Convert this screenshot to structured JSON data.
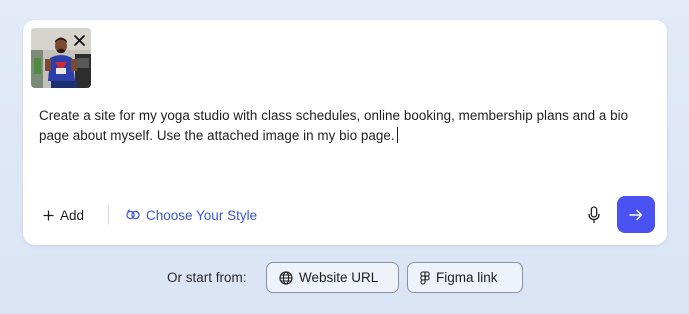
{
  "composer": {
    "attachment_alt": "Attached photo",
    "remove_icon": "close-icon",
    "prompt_text": "Create a site for my yoga studio with class schedules, online booking, membership plans and a bio page about myself. Use the attached image in my bio page.",
    "add_label": "Add",
    "add_icon": "plus-icon",
    "style_label": "Choose Your Style",
    "style_icon": "palette-icon",
    "mic_icon": "microphone-icon",
    "send_icon": "arrow-right-icon"
  },
  "start_from": {
    "label": "Or start from:",
    "options": [
      {
        "label": "Website URL",
        "icon": "globe-icon"
      },
      {
        "label": "Figma link",
        "icon": "figma-icon"
      }
    ]
  },
  "colors": {
    "background": "#dbe5f6",
    "card": "#ffffff",
    "accent": "#4b52f2",
    "link": "#3b55d8",
    "text": "#1f1f1f"
  }
}
